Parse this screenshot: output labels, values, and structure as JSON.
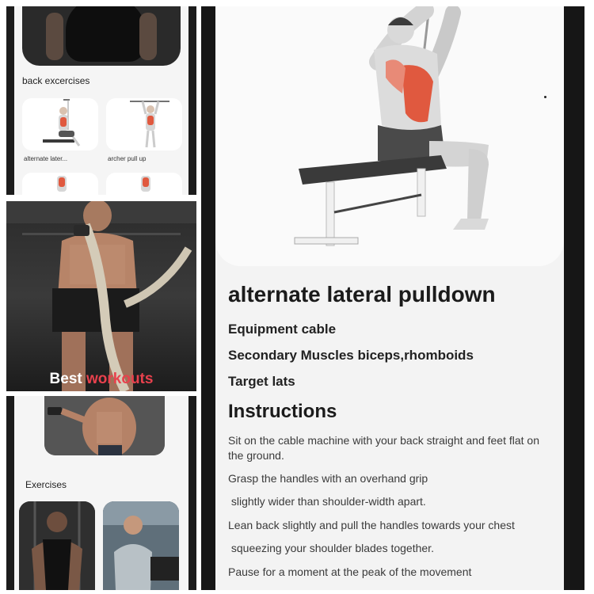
{
  "left_panels": {
    "top": {
      "section_title": "back excercises",
      "items": [
        {
          "label": "alternate later..."
        },
        {
          "label": "archer pull up"
        }
      ]
    },
    "middle": {
      "promo_prefix": "Best",
      "promo_accent": "workouts"
    },
    "bottom": {
      "section_title": "Exercises"
    }
  },
  "detail": {
    "exercise_name": "alternate lateral pulldown",
    "equipment": {
      "label": "Equipment",
      "value": "cable"
    },
    "secondary_muscles": {
      "label": "Secondary Muscles",
      "value": "biceps,rhomboids"
    },
    "target": {
      "label": "Target",
      "value": "lats"
    },
    "instructions_title": "Instructions",
    "instructions": [
      "Sit on the cable machine with your back straight and feet flat on the ground.",
      "Grasp the handles with an overhand grip",
      " slightly wider than shoulder-width apart.",
      "Lean back slightly and pull the handles towards your chest",
      " squeezing your shoulder blades together.",
      "Pause for a moment at the peak of the movement"
    ]
  },
  "colors": {
    "accent": "#e8414d",
    "muscle_highlight": "#e0593f",
    "bench": "#3a3a3a"
  }
}
